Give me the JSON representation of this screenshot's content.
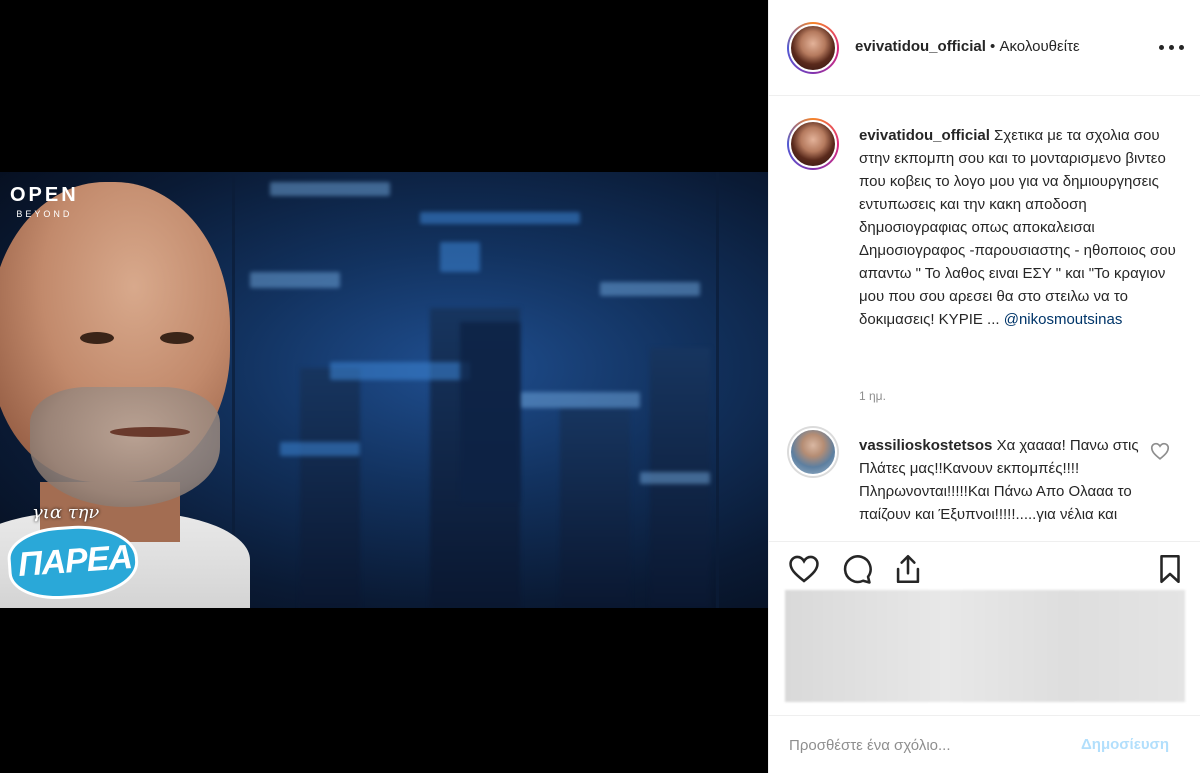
{
  "post": {
    "username": "evivatidou_official",
    "follow_status": "• Ακολουθείτε",
    "brand_logo_line1": "OPEN",
    "brand_logo_line2": "BEYOND",
    "show_logo_small": "για την",
    "show_logo_big": "ΠΑΡΕΑ"
  },
  "caption": {
    "username": "evivatidou_official",
    "text": "Σχετικα με τα σχολια σου στην εκπομπη σου και το μονταρισμενο βιντεο που κοβεις το λογο μου για να δημιουργησεις εντυπωσεις και την κακη αποδοση δημοσιογραφιας οπως αποκαλεισαι Δημοσιογραφος -παρουσιαστης - ηθοποιος σου απαντω \" Το λαθος ειναι ΕΣΥ \" και \"Το κραγιον μου που σου αρεσει θα στο στειλω να το δοκιμασεις! ΚΥΡΙΕ ...",
    "mention": "@nikosmoutsinas",
    "time": "1 ημ."
  },
  "comment": {
    "username": "vassilioskostetsos",
    "text": "Χα χαααα! Πανω στις Πλάτες μας!!Κανουν εκπομπές!!!!Πληρωνονται!!!!!Και Πάνω Απο Ολααα το παίζουν και Έξυπνοι!!!!!.....για νέλια και"
  },
  "actions": {
    "like": "heart-icon",
    "comment": "comment-icon",
    "share": "share-icon",
    "save": "bookmark-icon"
  },
  "compose": {
    "placeholder": "Προσθέστε ένα σχόλιο...",
    "post_label": "Δημοσίευση"
  },
  "colors": {
    "text": "#262626",
    "muted": "#8e8e8e",
    "link": "#003569",
    "post_disabled": "#b2dffc"
  }
}
